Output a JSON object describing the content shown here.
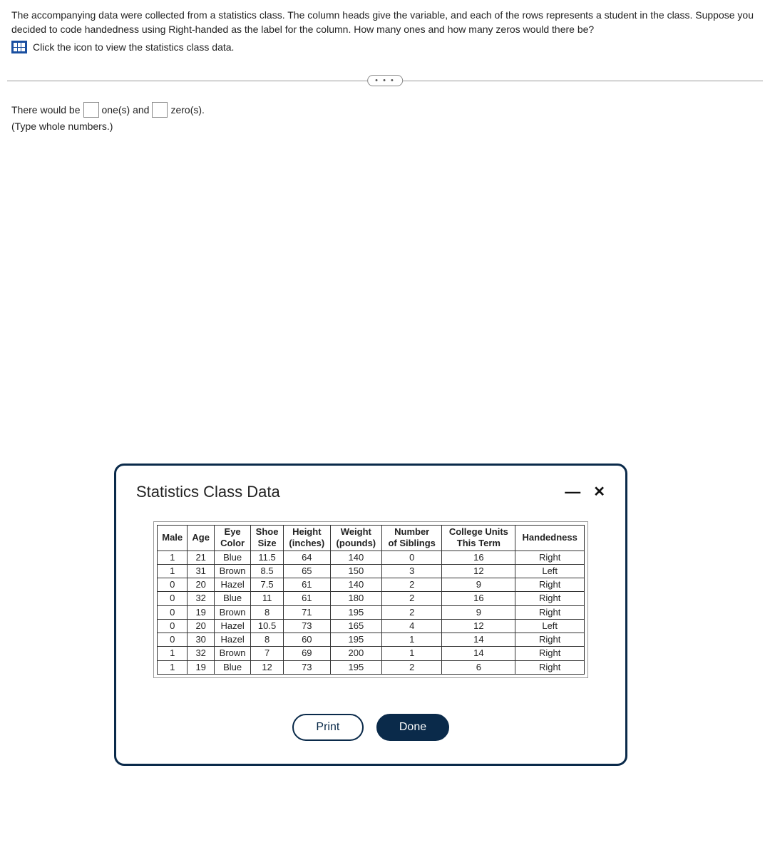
{
  "question": {
    "prompt": "The accompanying data were collected from a statistics class. The column heads give the variable, and each of the rows represents a student in the class. Suppose you decided to code handedness using Right-handed as the label for the column. How many ones and how many zeros would there be?",
    "icon_hint": "Click the icon to view the statistics class data."
  },
  "ellipsis": "• • •",
  "answer": {
    "prefix": "There would be",
    "mid": "one(s) and",
    "suffix": "zero(s).",
    "hint": "(Type whole numbers.)",
    "input1": "",
    "input2": ""
  },
  "modal": {
    "title": "Statistics Class Data",
    "print_label": "Print",
    "done_label": "Done",
    "headers": {
      "male": "Male",
      "age": "Age",
      "eye": "Eye Color",
      "shoe": "Shoe Size",
      "height": "Height (inches)",
      "weight": "Weight (pounds)",
      "siblings": "Number of Siblings",
      "units": "College Units This Term",
      "hand": "Handedness"
    },
    "rows": [
      {
        "male": "1",
        "age": "21",
        "eye": "Blue",
        "shoe": "11.5",
        "height": "64",
        "weight": "140",
        "siblings": "0",
        "units": "16",
        "hand": "Right"
      },
      {
        "male": "1",
        "age": "31",
        "eye": "Brown",
        "shoe": "8.5",
        "height": "65",
        "weight": "150",
        "siblings": "3",
        "units": "12",
        "hand": "Left"
      },
      {
        "male": "0",
        "age": "20",
        "eye": "Hazel",
        "shoe": "7.5",
        "height": "61",
        "weight": "140",
        "siblings": "2",
        "units": "9",
        "hand": "Right"
      },
      {
        "male": "0",
        "age": "32",
        "eye": "Blue",
        "shoe": "11",
        "height": "61",
        "weight": "180",
        "siblings": "2",
        "units": "16",
        "hand": "Right"
      },
      {
        "male": "0",
        "age": "19",
        "eye": "Brown",
        "shoe": "8",
        "height": "71",
        "weight": "195",
        "siblings": "2",
        "units": "9",
        "hand": "Right"
      },
      {
        "male": "0",
        "age": "20",
        "eye": "Hazel",
        "shoe": "10.5",
        "height": "73",
        "weight": "165",
        "siblings": "4",
        "units": "12",
        "hand": "Left"
      },
      {
        "male": "0",
        "age": "30",
        "eye": "Hazel",
        "shoe": "8",
        "height": "60",
        "weight": "195",
        "siblings": "1",
        "units": "14",
        "hand": "Right"
      },
      {
        "male": "1",
        "age": "32",
        "eye": "Brown",
        "shoe": "7",
        "height": "69",
        "weight": "200",
        "siblings": "1",
        "units": "14",
        "hand": "Right"
      },
      {
        "male": "1",
        "age": "19",
        "eye": "Blue",
        "shoe": "12",
        "height": "73",
        "weight": "195",
        "siblings": "2",
        "units": "6",
        "hand": "Right"
      }
    ]
  }
}
